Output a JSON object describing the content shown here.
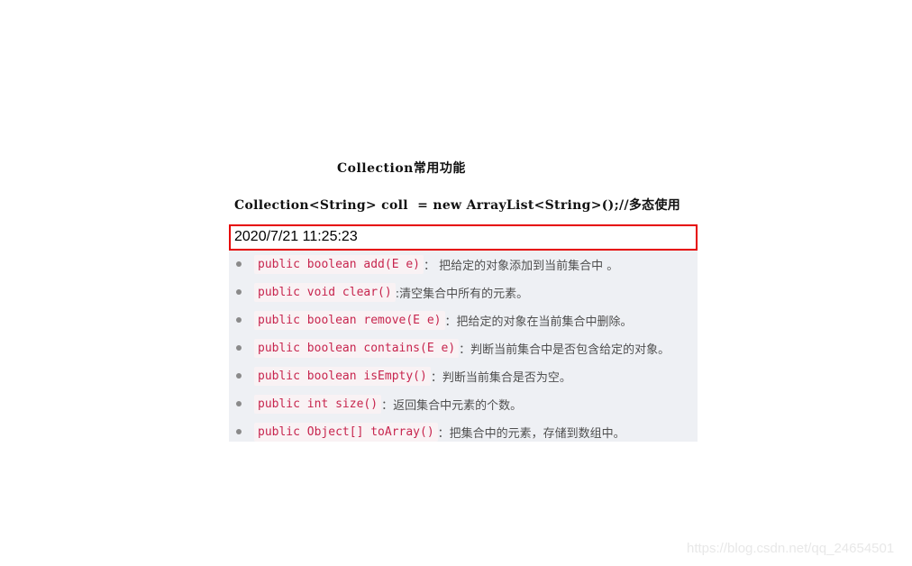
{
  "heading": "Collection常用功能",
  "code_line": "Collection<String> coll  = new ArrayList<String>();//多态使用",
  "timestamp": "2020/7/21 11:25:23",
  "methods": [
    {
      "signature": "public boolean add(E e)",
      "description": "：  把给定的对象添加到当前集合中 。"
    },
    {
      "signature": "public void clear()",
      "description": " :清空集合中所有的元素。"
    },
    {
      "signature": "public boolean remove(E e)",
      "description": "：把给定的对象在当前集合中删除。"
    },
    {
      "signature": "public boolean contains(E e)",
      "description": "：判断当前集合中是否包含给定的对象。"
    },
    {
      "signature": "public boolean isEmpty()",
      "description": "：判断当前集合是否为空。"
    },
    {
      "signature": "public int size()",
      "description": "：返回集合中元素的个数。"
    },
    {
      "signature": "public Object[] toArray()",
      "description": "：把集合中的元素，存储到数组中。"
    }
  ],
  "watermark": "https://blog.csdn.net/qq_24654501",
  "colors": {
    "highlight_border": "#e60000",
    "code_text": "#c7254e",
    "code_background": "#f9f2f4",
    "panel_background": "#eef0f4"
  }
}
